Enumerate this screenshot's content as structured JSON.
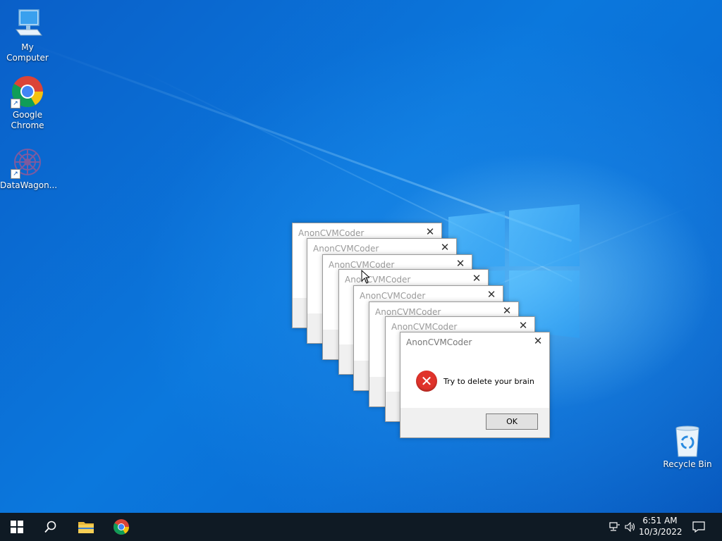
{
  "desktop": {
    "icons": [
      {
        "label": "My Computer"
      },
      {
        "label": "Google\nChrome"
      },
      {
        "label": "DataWagon..."
      },
      {
        "label": "Recycle Bin"
      }
    ]
  },
  "dialogs": {
    "title": "AnonCVMCoder",
    "message": "Try to delete your brain",
    "ok_label": "OK",
    "close_glyph": "✕",
    "error_glyph": "✕"
  },
  "taskbar": {
    "clock_time": "6:51 AM",
    "clock_date": "10/3/2022"
  },
  "colors": {
    "accent": "#0b78dd",
    "error": "#e0332b",
    "taskbar": "#0f1a24"
  }
}
